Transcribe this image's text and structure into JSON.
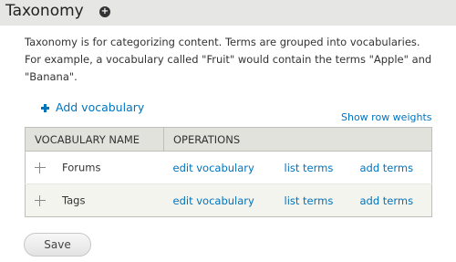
{
  "page": {
    "title": "Taxonomy"
  },
  "description": "Taxonomy is for categorizing content. Terms are grouped into vocabularies. For example, a vocabulary called \"Fruit\" would contain the terms \"Apple\" and \"Banana\".",
  "actions": {
    "add_vocabulary": "Add vocabulary",
    "show_row_weights": "Show row weights"
  },
  "table": {
    "headers": [
      "VOCABULARY NAME",
      "OPERATIONS"
    ],
    "rows": [
      {
        "name": "Forums",
        "edit": "edit vocabulary",
        "list": "list terms",
        "add": "add terms"
      },
      {
        "name": "Tags",
        "edit": "edit vocabulary",
        "list": "list terms",
        "add": "add terms"
      }
    ]
  },
  "form": {
    "save_label": "Save"
  },
  "colors": {
    "link": "#0074bd",
    "header_bg": "#e6e6e4",
    "table_header_bg": "#e1e2dc",
    "even_row_bg": "#f3f4ee"
  },
  "icons": {
    "add_shortcut": "add-shortcut-icon",
    "add": "plus-icon",
    "drag": "drag-handle-icon"
  }
}
